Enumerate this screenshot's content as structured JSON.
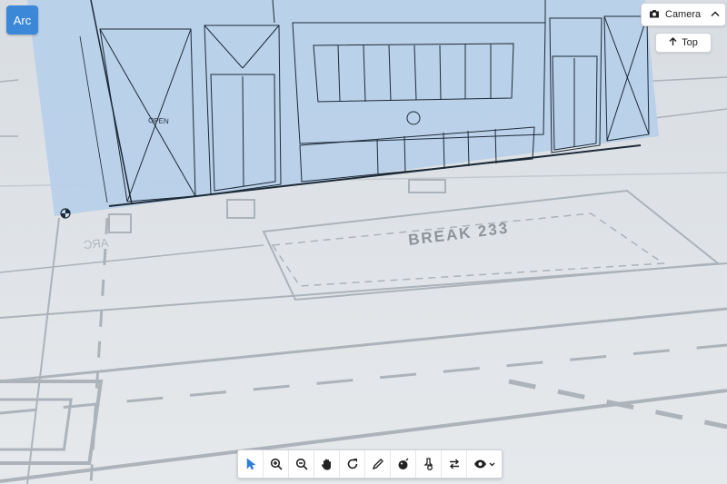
{
  "app": {
    "arc_label": "Arc"
  },
  "camera": {
    "label": "Camera",
    "top_label": "Top"
  },
  "drawing": {
    "room_label": "BREAK  233",
    "door_label": "OPEN",
    "mirror_label": "ARC"
  },
  "toolbar": {
    "tools": [
      {
        "name": "select-tool",
        "icon": "pointer-icon",
        "active": true
      },
      {
        "name": "zoom-in-tool",
        "icon": "zoom-in-icon",
        "active": false
      },
      {
        "name": "zoom-out-tool",
        "icon": "zoom-out-icon",
        "active": false
      },
      {
        "name": "pan-tool",
        "icon": "hand-icon",
        "active": false
      },
      {
        "name": "rotate-tool",
        "icon": "rotate-icon",
        "active": false
      },
      {
        "name": "markup-tool",
        "icon": "pencil-icon",
        "active": false
      },
      {
        "name": "camera-tool",
        "icon": "camera-ball-icon",
        "active": false
      },
      {
        "name": "measure-tool",
        "icon": "pin-icon",
        "active": false
      },
      {
        "name": "swap-tool",
        "icon": "swap-icon",
        "active": false
      },
      {
        "name": "view-tool",
        "icon": "eye-icon",
        "active": false
      }
    ]
  },
  "colors": {
    "accent": "#3b87d8",
    "elevation_fill": "#b6cfe9",
    "floor": "#dde2e7"
  }
}
